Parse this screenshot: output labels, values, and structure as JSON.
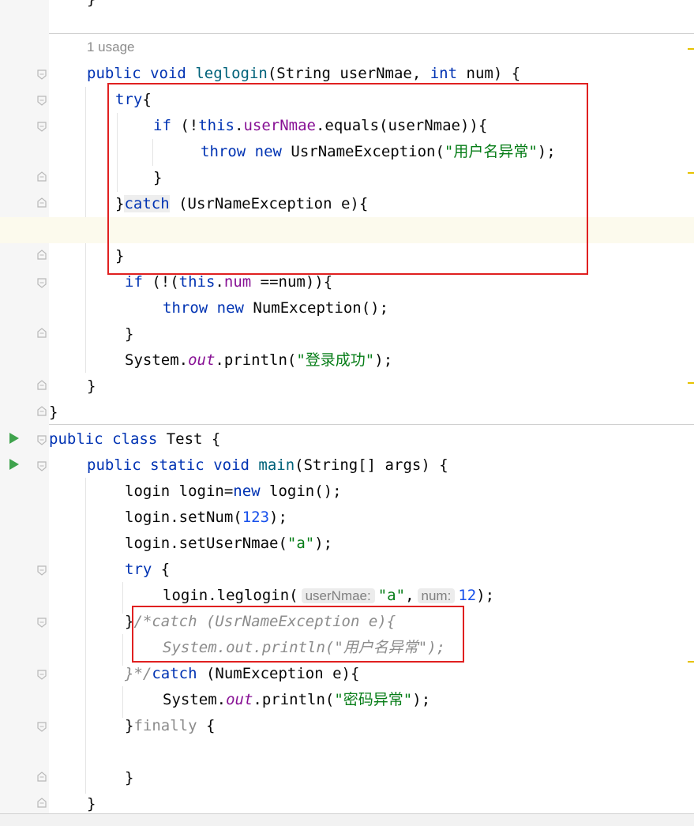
{
  "editor": {
    "usage_hint": "1 usage",
    "hints": {
      "userNmae": "userNmae:",
      "num": "num:"
    },
    "colors": {
      "keyword": "#0033b3",
      "field": "#871094",
      "string": "#067d17",
      "number": "#1750eb",
      "comment": "#8c8c8c",
      "annotation_box": "#e02020",
      "run_icon": "#3fa34d"
    },
    "lines": {
      "l0": "}",
      "l1": "public void leglogin(String userNmae, int num) {",
      "l2": "try{",
      "l3": "if (!this.userNmae.equals(userNmae)){",
      "l4": "throw new UsrNameException(\"用户名异常\");",
      "l5": "}",
      "l6": "}catch (UsrNameException e){",
      "l7": "",
      "l8": "}",
      "l9": "if (!(this.num ==num)){",
      "l10": "throw new NumException();",
      "l11": "}",
      "l12": "System.out.println(\"登录成功\");",
      "l13": "}",
      "l14": "}",
      "l15": "public class Test {",
      "l16": "public static void main(String[] args) {",
      "l17": "login login=new login();",
      "l18": "login.setNum(123);",
      "l19": "login.setUserNmae(\"a\");",
      "l20": "try {",
      "l21": "login.leglogin( userNmae: \"a\", num: 12);",
      "l22": "}/*catch (UsrNameException e){",
      "l23": "System.out.println(\"用户名异常\");",
      "l24": "}*/catch (NumException e){",
      "l25": "System.out.println(\"密码异常\");",
      "l26": "}finally {",
      "l27": "",
      "l28": "}",
      "l29": "}"
    },
    "tokens": {
      "public": "public",
      "void": "void",
      "static": "static",
      "class": "class",
      "int": "int",
      "try": "try",
      "if": "if",
      "throw": "throw",
      "new": "new",
      "catch": "catch",
      "this": "this",
      "finally": "finally",
      "userNmae_field": "userNmae",
      "num_field": "num",
      "out": "out",
      "str_user_err": "\"用户名异常\"",
      "str_login_ok": "\"登录成功\"",
      "str_pwd_err": "\"密码异常\"",
      "str_a": "\"a\"",
      "num_123": "123",
      "num_12": "12"
    }
  }
}
